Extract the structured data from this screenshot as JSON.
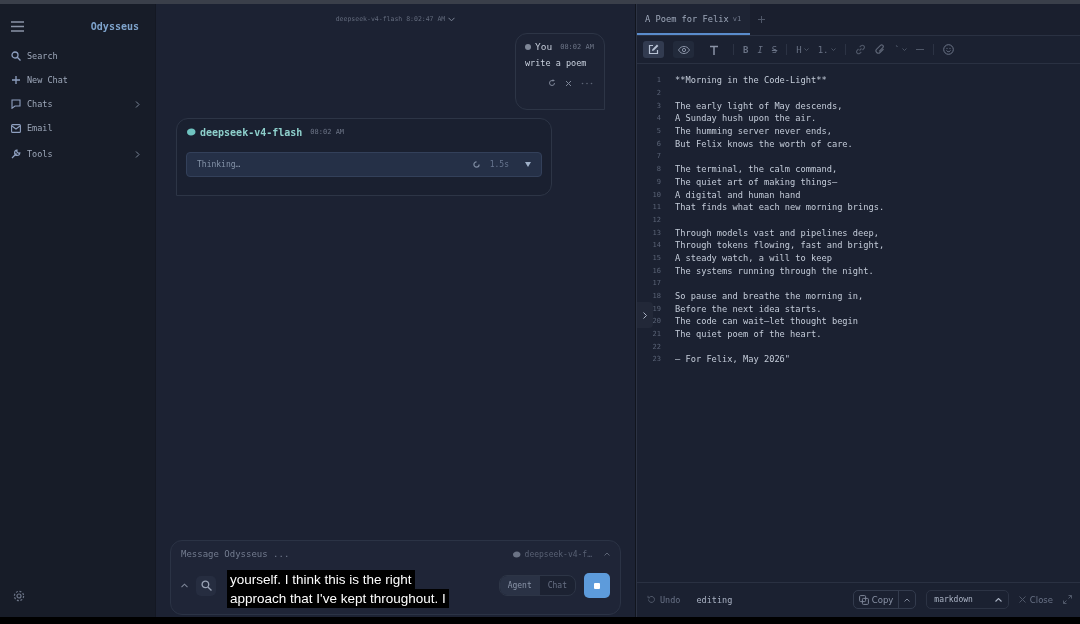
{
  "sidebar": {
    "brand": "Odysseus",
    "items": [
      {
        "kind": "search",
        "label": "Search",
        "expandable": false
      },
      {
        "kind": "plus",
        "label": "New Chat",
        "expandable": false
      },
      {
        "kind": "chat",
        "label": "Chats",
        "expandable": true
      },
      {
        "kind": "mail",
        "label": "Email",
        "expandable": false
      },
      {
        "kind": "wrench",
        "label": "Tools",
        "expandable": true
      }
    ]
  },
  "chat": {
    "header": "deepseek-v4-flash 8:02:47 AM",
    "user_message": {
      "author": "You",
      "time": "08:02 AM",
      "text": "write a poem"
    },
    "assistant_message": {
      "model": "deepseek-v4-flash",
      "time": "08:02 AM",
      "thinking": {
        "label": "Thinking…",
        "duration": "1.5s",
        "expanded": false
      }
    },
    "composer": {
      "placeholder": "Message Odysseus ...",
      "model": "deepseek-v4-f…",
      "modes": [
        {
          "label": "Agent",
          "selected": true
        },
        {
          "label": "Chat",
          "selected": false
        }
      ]
    },
    "subtitle": [
      "yourself. I think this is the right",
      "approach that I've kept throughout. I"
    ]
  },
  "artifact": {
    "tabs": [
      {
        "title": "A Poem for Felix",
        "version": "v1",
        "selected": true
      }
    ],
    "toolbar": [
      {
        "kind": "edit",
        "selected": true
      },
      {
        "kind": "eye",
        "selected": false
      },
      {
        "kind": "type",
        "selected": false
      },
      {
        "kind": "sep"
      },
      {
        "kind": "text",
        "label": "B"
      },
      {
        "kind": "text",
        "label": "I"
      },
      {
        "kind": "text",
        "label": "S"
      },
      {
        "kind": "sep"
      },
      {
        "kind": "dropdown",
        "label": "H"
      },
      {
        "kind": "dropdown",
        "label": "1."
      },
      {
        "kind": "sep"
      },
      {
        "kind": "link"
      },
      {
        "kind": "clip"
      },
      {
        "kind": "dropdown",
        "label": "`"
      },
      {
        "kind": "rule"
      },
      {
        "kind": "sep"
      },
      {
        "kind": "smile"
      }
    ],
    "lines": [
      {
        "number": "1",
        "text": "**Morning in the Code-Light**"
      },
      {
        "number": "2"
      },
      {
        "number": "3",
        "text": "The early light of May descends,"
      },
      {
        "number": "4",
        "text": "A Sunday hush upon the air."
      },
      {
        "number": "5",
        "text": "The humming server never ends,"
      },
      {
        "number": "6",
        "text": "But Felix knows the worth of care."
      },
      {
        "number": "7"
      },
      {
        "number": "8",
        "text": "The terminal, the calm command,"
      },
      {
        "number": "9",
        "text": "The quiet art of making things—"
      },
      {
        "number": "10",
        "text": "A digital and human hand"
      },
      {
        "number": "11",
        "text": "That finds what each new morning brings."
      },
      {
        "number": "12"
      },
      {
        "number": "13",
        "text": "Through models vast and pipelines deep,"
      },
      {
        "number": "14",
        "text": "Through tokens flowing, fast and bright,"
      },
      {
        "number": "15",
        "text": "A steady watch, a will to keep"
      },
      {
        "number": "16",
        "text": "The systems running through the night."
      },
      {
        "number": "17"
      },
      {
        "number": "18",
        "text": "So pause and breathe the morning in,"
      },
      {
        "number": "19",
        "text": "Before the next idea starts."
      },
      {
        "number": "20",
        "text": "The code can wait—let thought begin"
      },
      {
        "number": "21",
        "text": "The quiet poem of the heart."
      },
      {
        "number": "22"
      },
      {
        "number": "23",
        "text": "— For Felix, May 2026\""
      }
    ],
    "footer": {
      "undo": "Undo",
      "status": "editing",
      "copy": "Copy",
      "format": "markdown",
      "close": "Close"
    }
  }
}
